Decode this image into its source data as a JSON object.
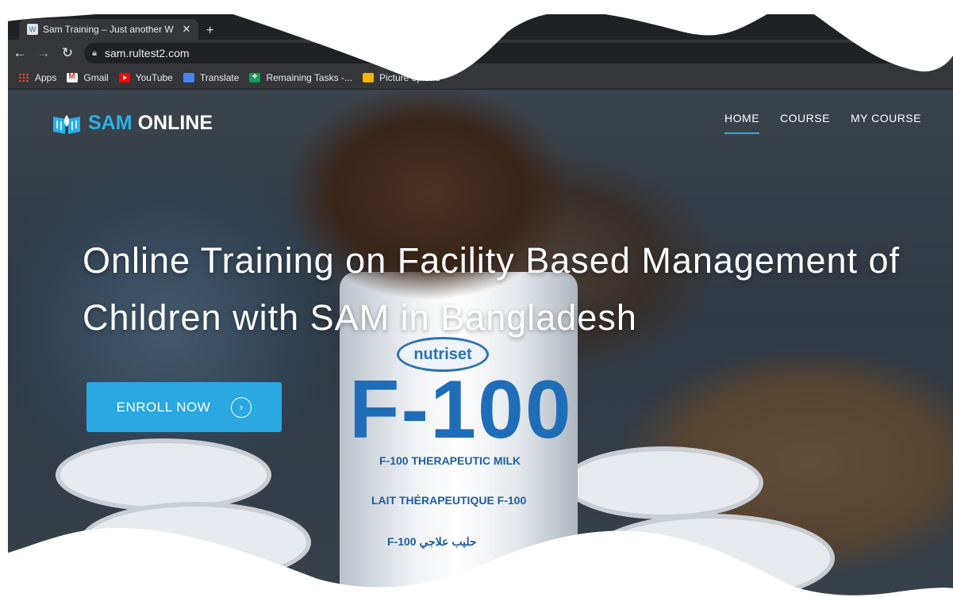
{
  "browser": {
    "tab_title": "Sam Training – Just another W",
    "address": "sam.rultest2.com",
    "bookmarks": [
      {
        "label": "Apps",
        "icon": "apps-grid-icon"
      },
      {
        "label": "Gmail",
        "icon": "gmail-icon"
      },
      {
        "label": "YouTube",
        "icon": "youtube-icon"
      },
      {
        "label": "Translate",
        "icon": "translate-icon"
      },
      {
        "label": "Remaining Tasks -...",
        "icon": "sheets-icon"
      },
      {
        "label": "Picture upload",
        "icon": "picture-icon"
      }
    ]
  },
  "site": {
    "logo_sam": "SAM",
    "logo_online": "ONLINE",
    "menu": [
      "HOME",
      "COURSE",
      "MY COURSE"
    ],
    "active_menu": "HOME",
    "headline": "Online Training on Facility Based Management of Children with SAM in Bangladesh",
    "cta_label": "ENROLL NOW",
    "accent_color": "#29a8e1"
  },
  "photo": {
    "brand": "nutriset",
    "product": "F-100",
    "label_en": "F-100 THERAPEUTIC MILK",
    "label_fr": "LAIT THÉRAPEUTIQUE F-100",
    "label_ar": "F-100 حليب علاجي"
  }
}
